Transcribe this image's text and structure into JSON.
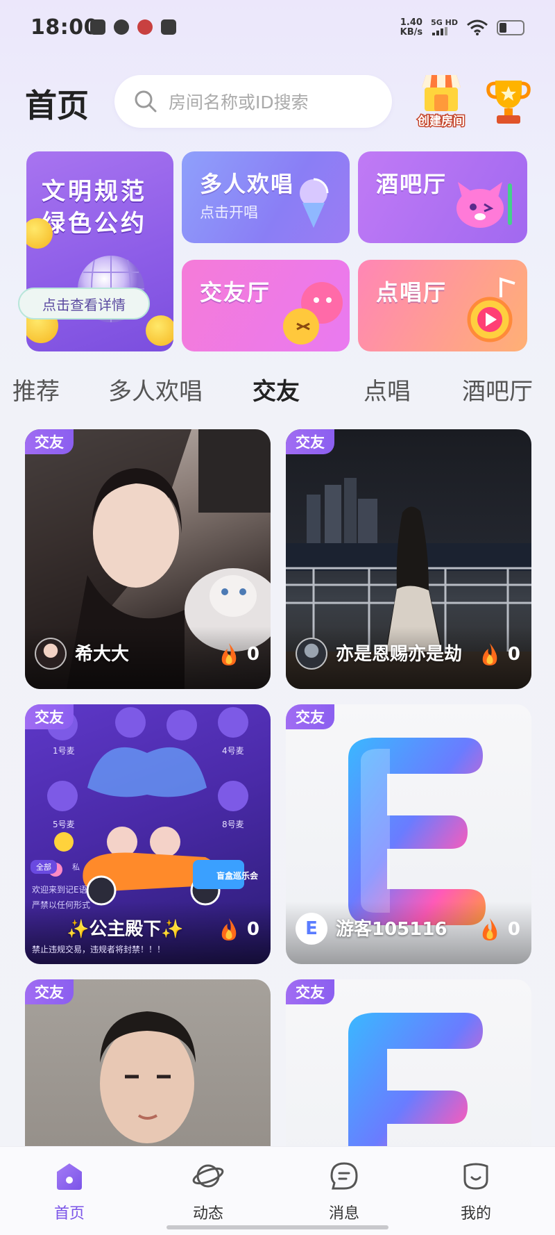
{
  "status_bar": {
    "time": "18:00",
    "net_speed": "1.40",
    "net_unit": "KB/s",
    "signal": "5G HD"
  },
  "header": {
    "title": "首页",
    "search_placeholder": "房间名称或ID搜索",
    "create_room_label": "创建房间"
  },
  "features": {
    "banner_line1": "文明规范",
    "banner_line2": "绿色公约",
    "banner_button": "点击查看详情",
    "multi_title": "多人欢唱",
    "multi_sub": "点击开唱",
    "bar_title": "酒吧厅",
    "friend_title": "交友厅",
    "song_title": "点唱厅"
  },
  "tabs": [
    "推荐",
    "多人欢唱",
    "交友",
    "点唱",
    "酒吧厅"
  ],
  "active_tab": "交友",
  "rooms": [
    {
      "tag": "交友",
      "name": "希大大",
      "heat": "0"
    },
    {
      "tag": "交友",
      "name": "亦是恩赐亦是劫",
      "heat": "0"
    },
    {
      "tag": "交友",
      "name": "✨公主殿下✨",
      "heat": "0"
    },
    {
      "tag": "交友",
      "name": "游客105116",
      "heat": "0"
    },
    {
      "tag": "交友",
      "name": "",
      "heat": ""
    },
    {
      "tag": "交友",
      "name": "",
      "heat": ""
    }
  ],
  "room3_overlay": {
    "mic_labels": [
      "1号麦",
      "4号麦",
      "5号麦",
      "8号麦"
    ],
    "chat_tabs": [
      "全部",
      "私"
    ],
    "welcome": "欢迎来到记E语",
    "rule1": "严禁以任何形式",
    "rule2": "禁止违规交易，违规者将封禁！！！",
    "badge": "盲盒巡乐会"
  },
  "room4_avatar_letter": "E",
  "bottom_nav": [
    {
      "label": "首页",
      "icon": "home-icon"
    },
    {
      "label": "动态",
      "icon": "planet-icon"
    },
    {
      "label": "消息",
      "icon": "message-icon"
    },
    {
      "label": "我的",
      "icon": "profile-icon"
    }
  ],
  "colors": {
    "accent": "#7b54e8",
    "tag": "#8b5ff0",
    "fire": "#ff6a1a"
  }
}
